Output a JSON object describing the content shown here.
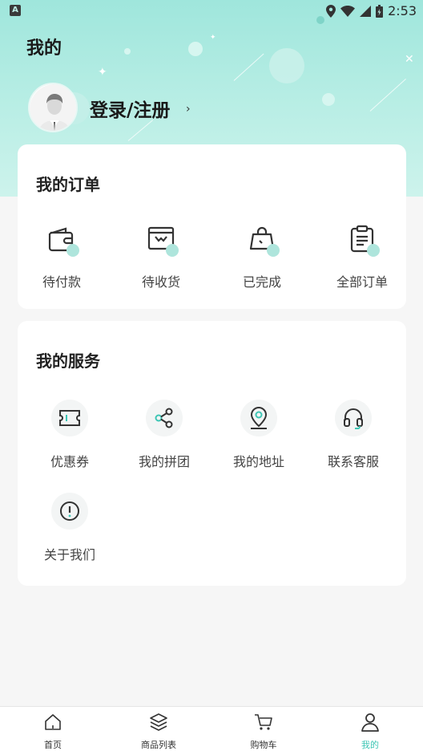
{
  "status_bar": {
    "time": "2:53",
    "left_badge": "A"
  },
  "header": {
    "title": "我的",
    "login_label": "登录/注册",
    "chevron": "›"
  },
  "orders": {
    "title": "我的订单",
    "items": [
      {
        "label": "待付款",
        "icon": "wallet-icon"
      },
      {
        "label": "待收货",
        "icon": "package-icon"
      },
      {
        "label": "已完成",
        "icon": "shopping-bag-icon"
      },
      {
        "label": "全部订单",
        "icon": "clipboard-icon"
      }
    ]
  },
  "services": {
    "title": "我的服务",
    "items": [
      {
        "label": "优惠券",
        "icon": "coupon-icon"
      },
      {
        "label": "我的拼团",
        "icon": "share-icon"
      },
      {
        "label": "我的地址",
        "icon": "location-pin-icon"
      },
      {
        "label": "联系客服",
        "icon": "headset-icon"
      },
      {
        "label": "关于我们",
        "icon": "info-icon"
      }
    ]
  },
  "tabbar": {
    "items": [
      {
        "label": "首页",
        "icon": "home-icon",
        "active": false
      },
      {
        "label": "商品列表",
        "icon": "layers-icon",
        "active": false
      },
      {
        "label": "购物车",
        "icon": "cart-icon",
        "active": false
      },
      {
        "label": "我的",
        "icon": "user-icon",
        "active": true
      }
    ],
    "active_color": "#3ec6b5"
  },
  "colors": {
    "accent": "#3ec6b5",
    "header_bg": "#a8e8df"
  }
}
